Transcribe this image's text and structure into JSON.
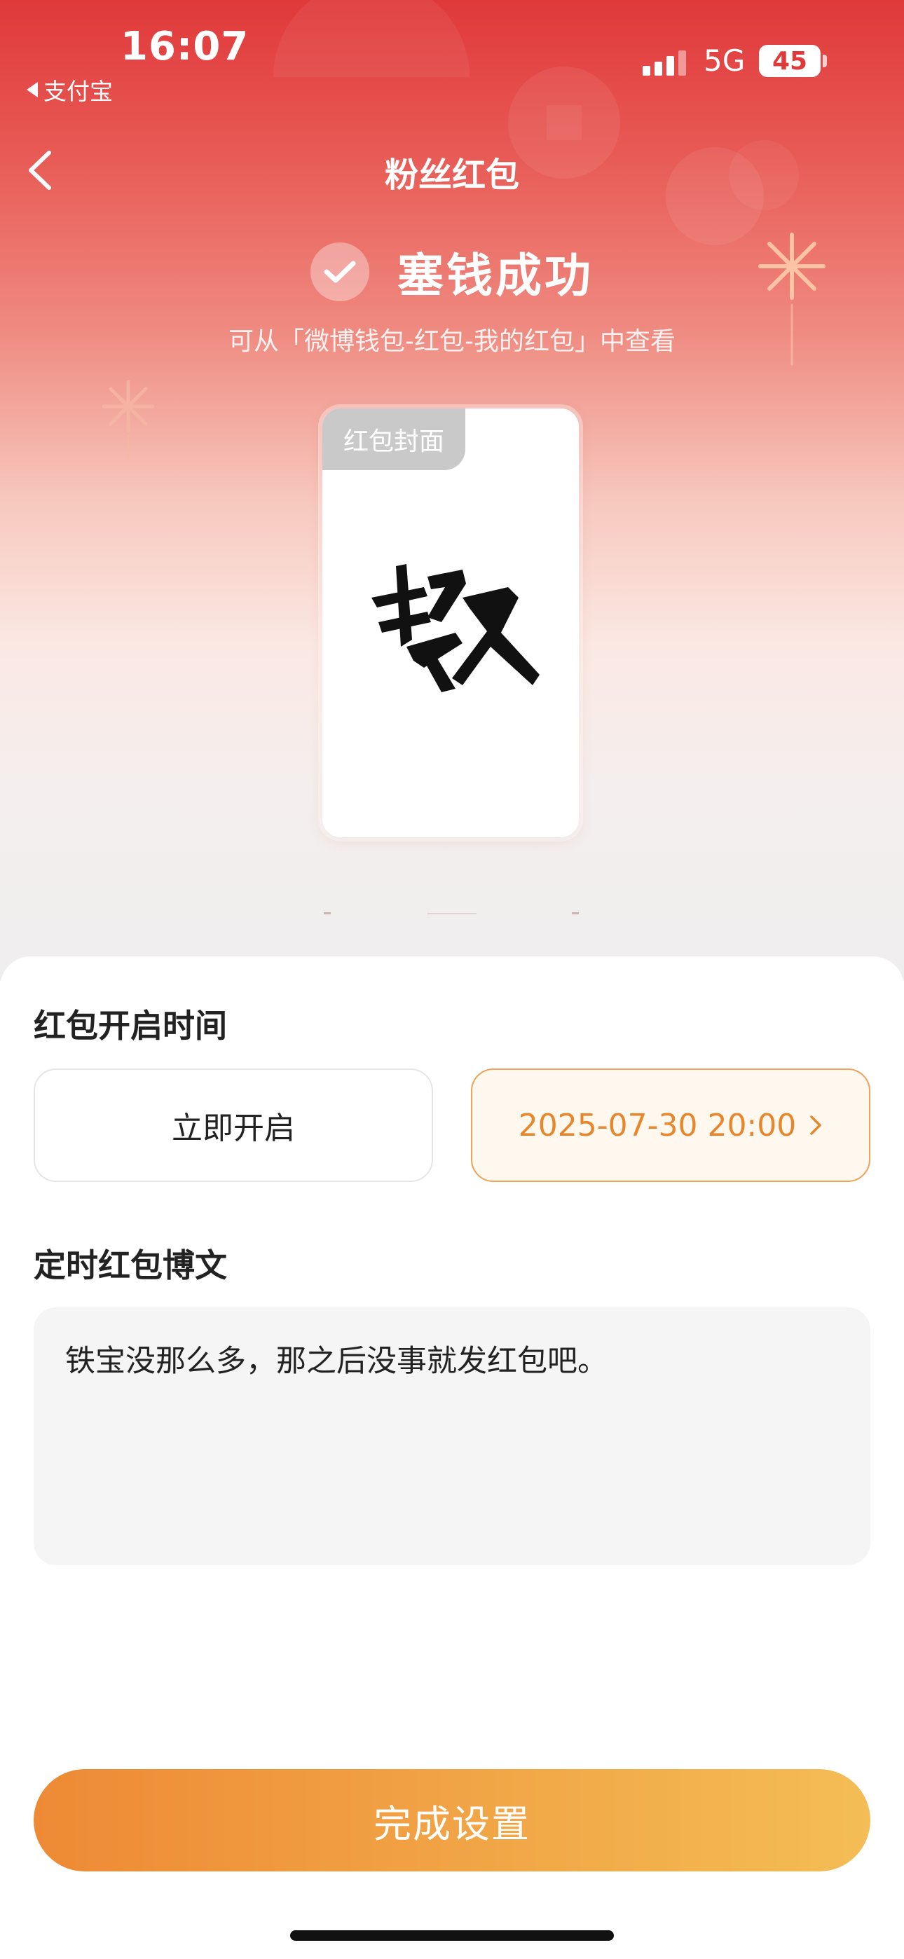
{
  "status_bar": {
    "time": "16:07",
    "back_app": "支付宝",
    "network": "5G",
    "battery": "45"
  },
  "nav": {
    "title": "粉丝红包"
  },
  "success": {
    "title": "塞钱成功",
    "subtitle": "可从「微博钱包-红包-我的红包」中查看"
  },
  "cover": {
    "tag": "红包封面",
    "art_text": "撒欢"
  },
  "open_time": {
    "title": "红包开启时间",
    "option_now": "立即开启",
    "option_scheduled": "2025-07-30 20:00",
    "selected": "scheduled"
  },
  "post": {
    "title": "定时红包博文",
    "content": "铁宝没那么多，那之后没事就发红包吧。"
  },
  "footer": {
    "done_label": "完成设置"
  },
  "colors": {
    "header_red": "#e0393a",
    "accent_orange": "#e8862c",
    "button_gradient_start": "#ee8a35",
    "button_gradient_end": "#f4bd55"
  },
  "icons": {
    "back": "chevron-left-icon",
    "success": "check-icon",
    "schedule_more": "chevron-right-icon"
  }
}
